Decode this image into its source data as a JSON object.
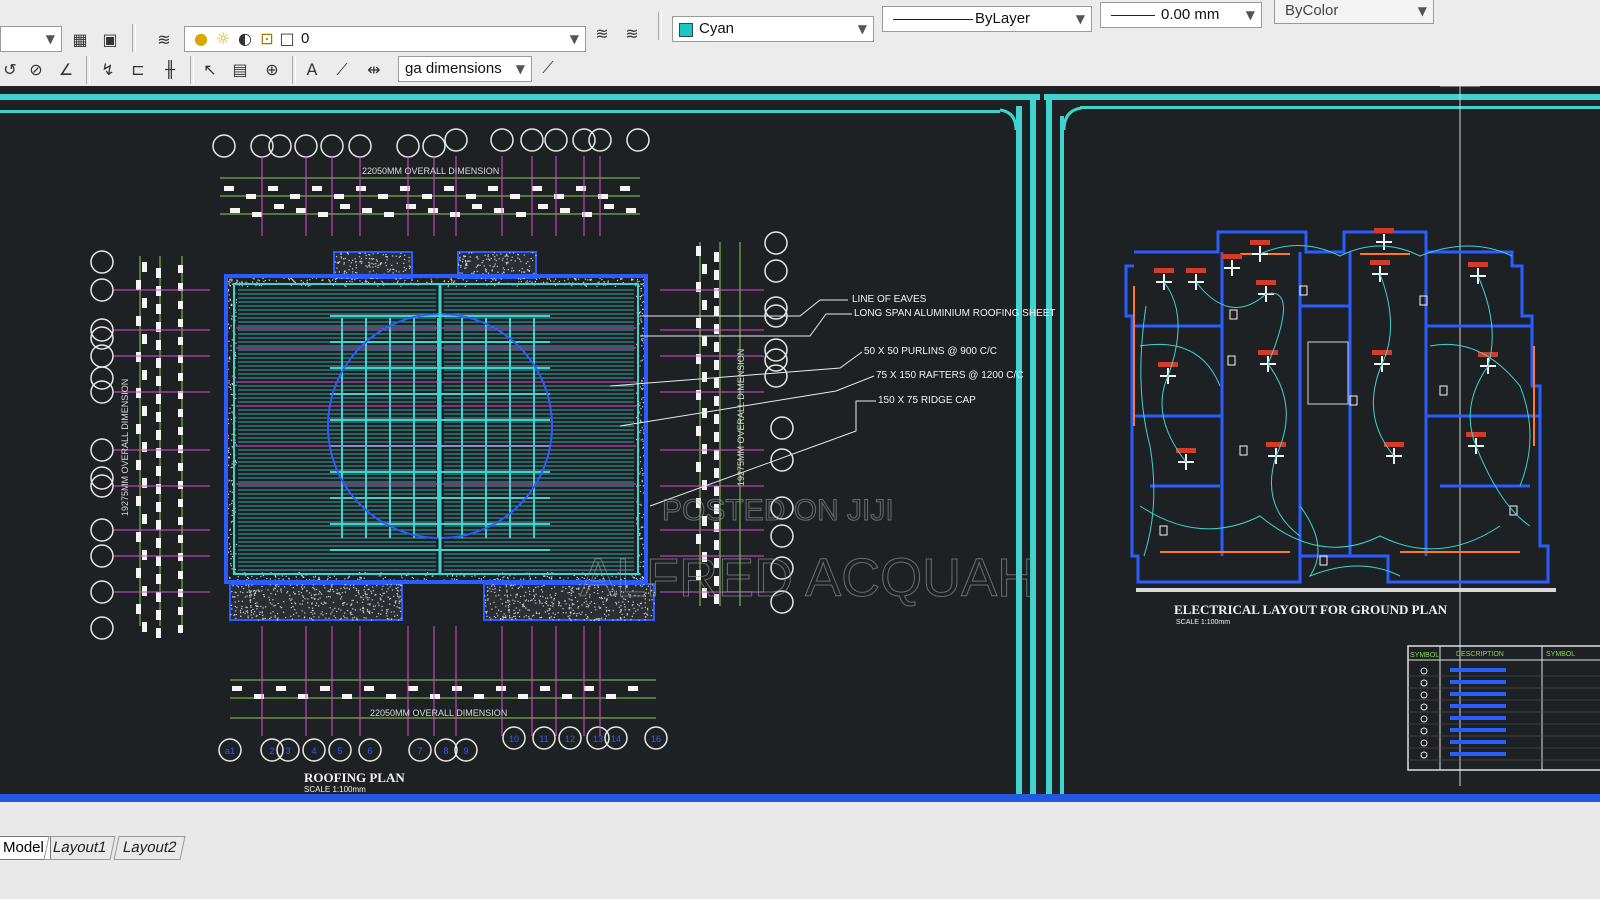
{
  "toolbar": {
    "layer_value": "0",
    "color_value": "Cyan",
    "linetype_value": "ByLayer",
    "lineweight_value": "0.00 mm",
    "plotstyle_value": "ByColor",
    "dimstyle_value": "ga dimensions"
  },
  "drawing": {
    "roofing_plan": {
      "title": "ROOFING PLAN",
      "scale": "SCALE 1:100mm",
      "top_dimension": "22050MM OVERALL DIMENSION",
      "bottom_dimension": "22050MM OVERALL DIMENSION",
      "left_dimension": "19275MM OVERALL DIMENSION",
      "right_dimension": "19275MM OVERALL DIMENSION",
      "notes": [
        "LINE OF EAVES",
        "LONG SPAN ALUMINIUM ROOFING SHEET",
        "50 X 50 PURLINS @ 900 C/C",
        "75 X 150 RAFTERS @ 1200 C/C",
        "150 X 75 RIDGE CAP"
      ],
      "bottom_grid_labels": [
        "a1",
        "2",
        "3",
        "4",
        "5",
        "6",
        "7",
        "8",
        "9",
        "10",
        "11",
        "12",
        "13",
        "14",
        "16"
      ]
    },
    "electrical_layout": {
      "title": "ELECTRICAL LAYOUT  FOR GROUND PLAN",
      "scale": "SCALE 1:100mm",
      "legend_headers": [
        "SYMBOL",
        "DESCRIPTION",
        "SYMBOL"
      ]
    },
    "watermark": {
      "line1": "POSTED ON JIJI",
      "line2": "ALFRED ACQUAH"
    }
  },
  "tabs": [
    "Model",
    "Layout1",
    "Layout2"
  ],
  "active_tab": "Model",
  "colors": {
    "background": "#1e2124",
    "viewport_border": "#3fd3d0",
    "layer_cyan": "#17c7c2",
    "magenta": "#d94fd6",
    "blue": "#2a5cff",
    "green": "#8fd14f"
  }
}
